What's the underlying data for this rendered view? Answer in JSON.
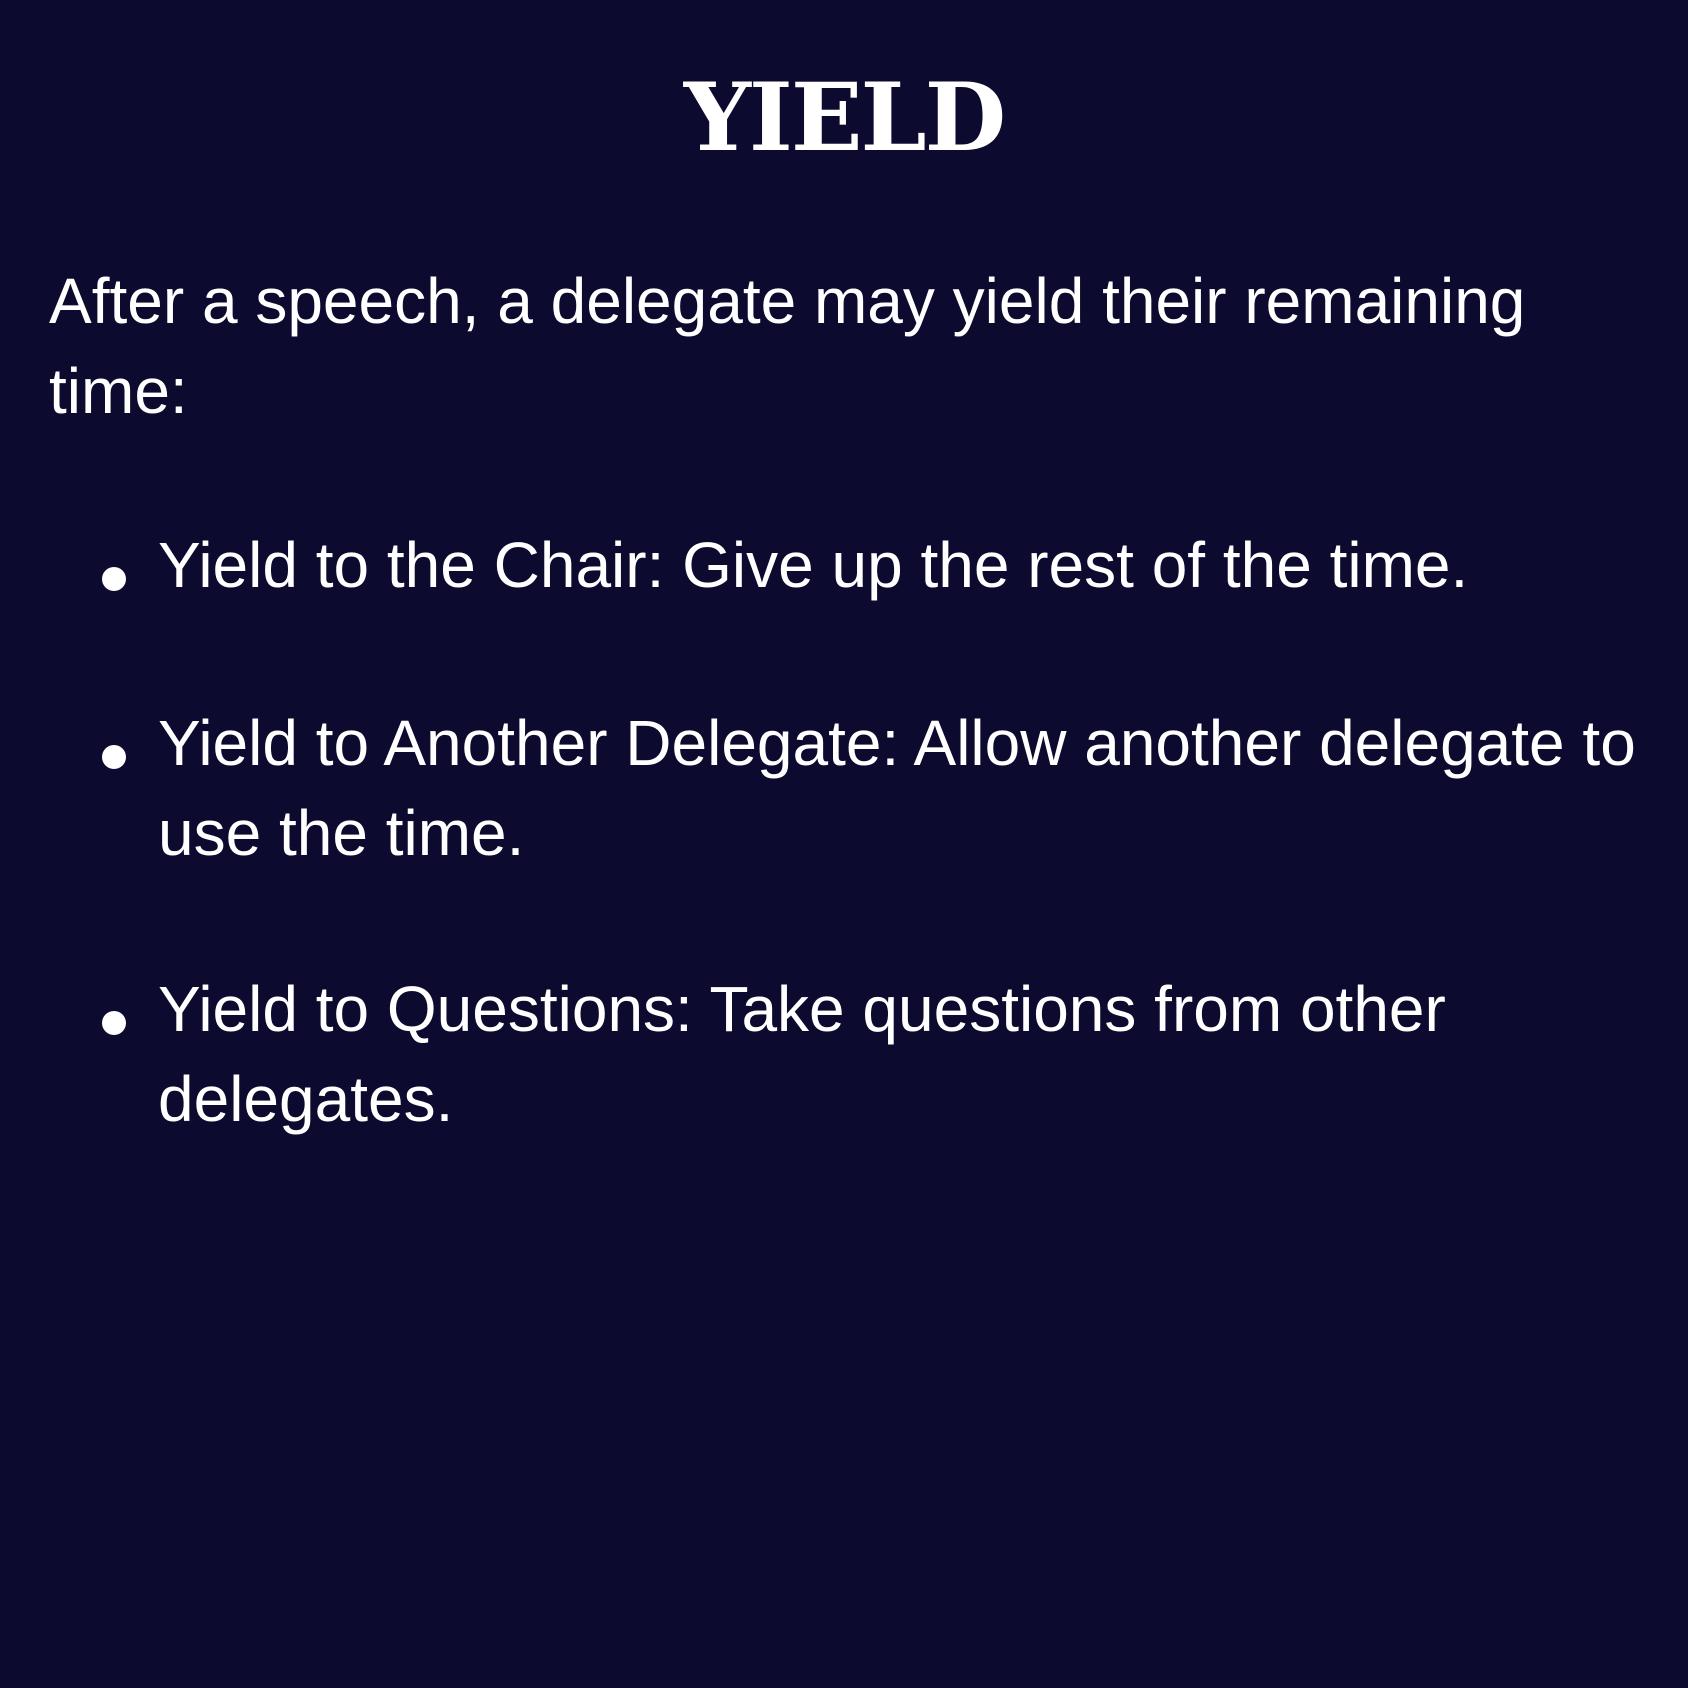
{
  "title": "YIELD",
  "intro": "After a speech, a delegate may yield their remaining time:",
  "options": [
    {
      "text": "Yield to the Chair: Give up the rest of the time."
    },
    {
      "text": "Yield to Another Delegate: Allow another delegate to use the time."
    },
    {
      "text": "Yield to Questions: Take questions from other delegates."
    }
  ],
  "colors": {
    "background": "#0d0a2f",
    "text": "#ffffff"
  }
}
